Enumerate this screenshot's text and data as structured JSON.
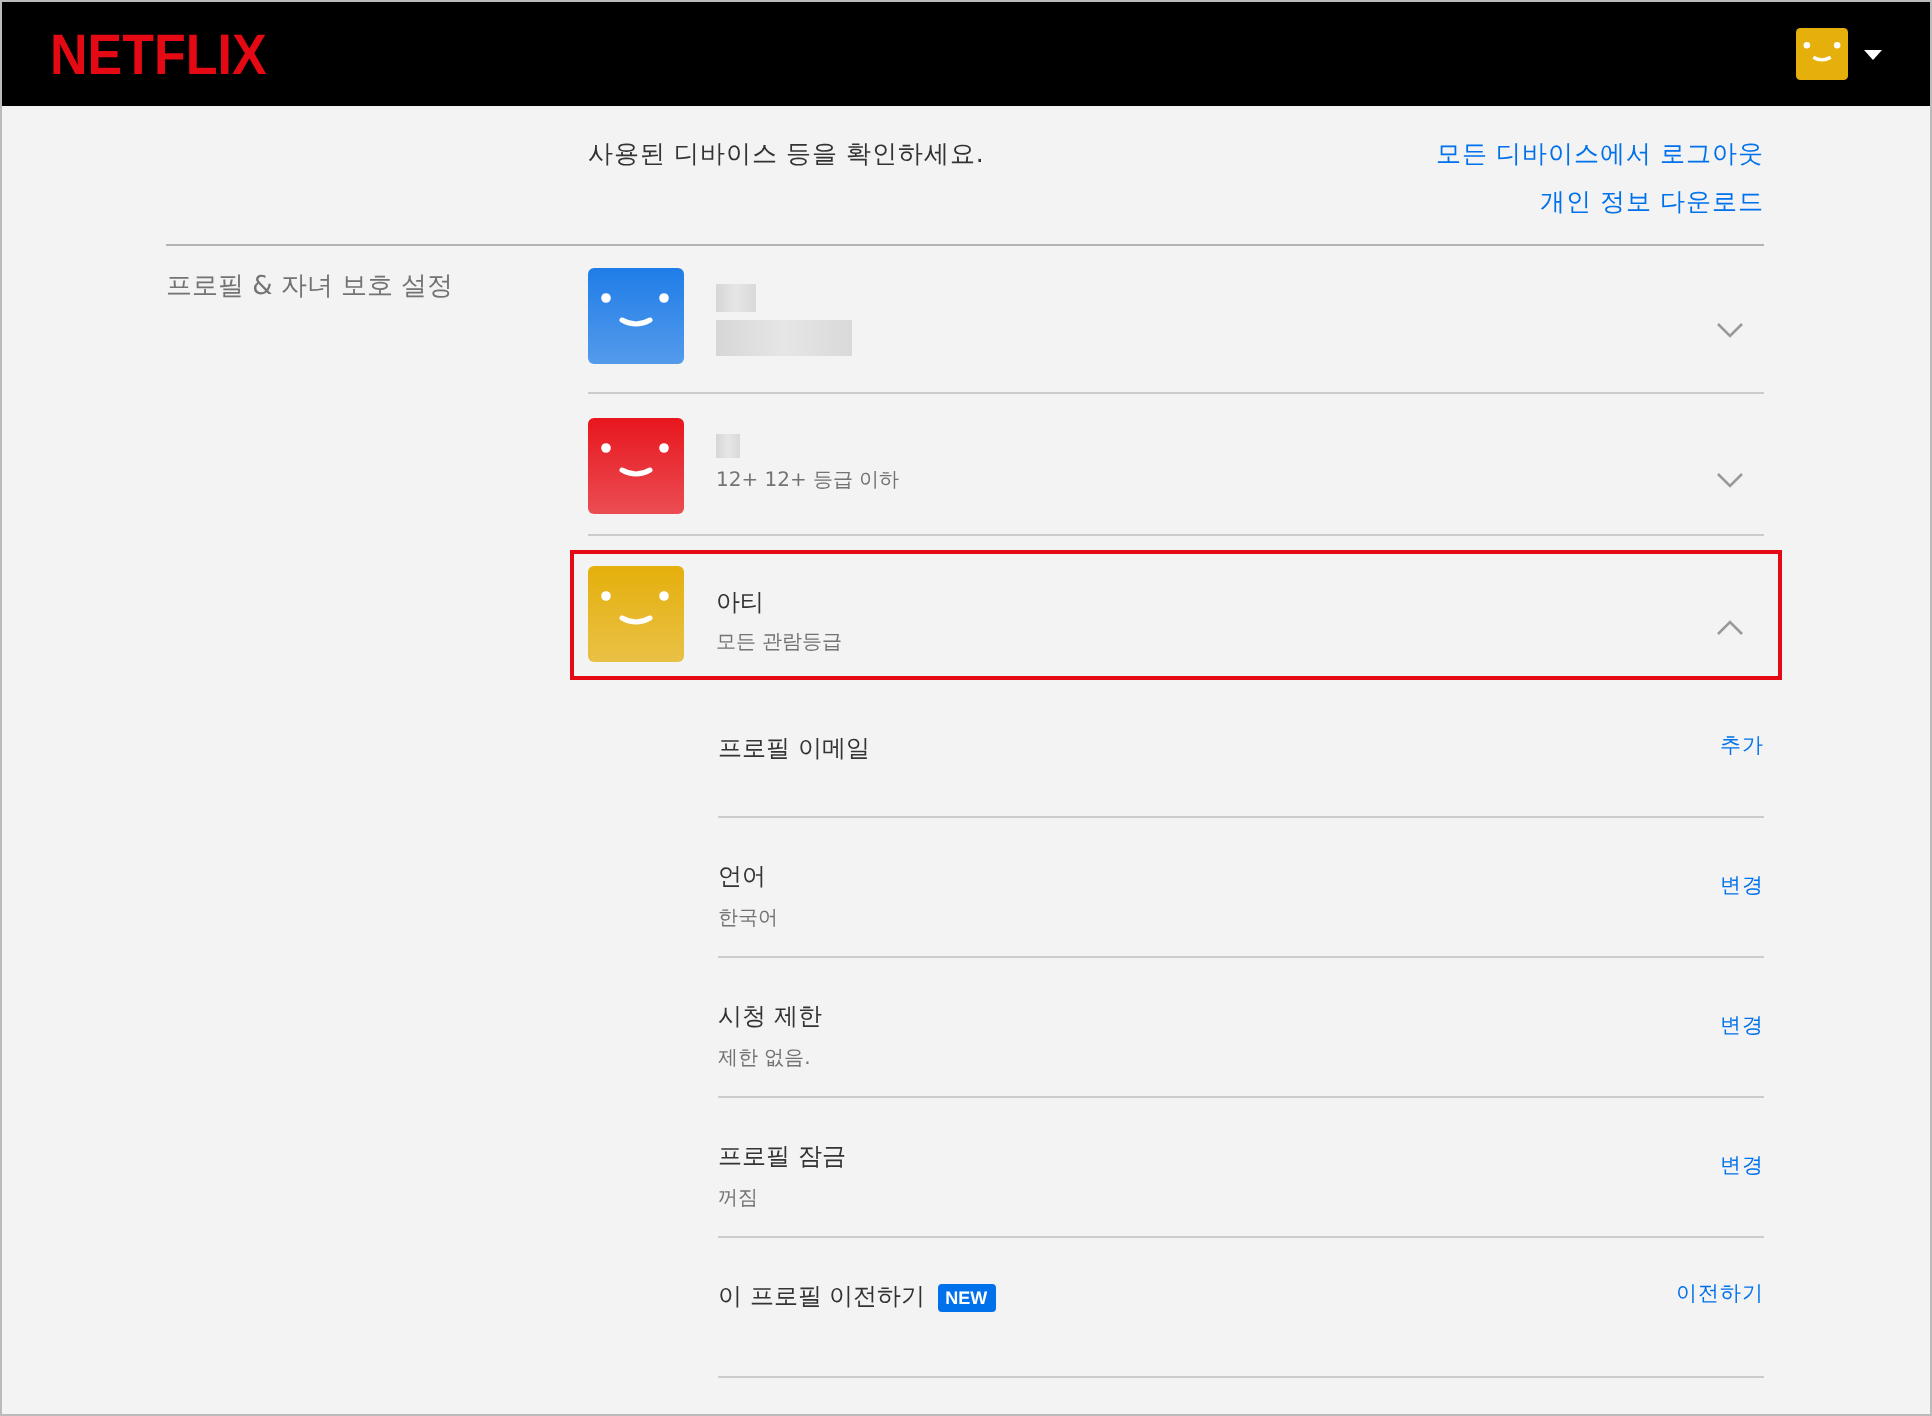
{
  "header": {
    "logo": "NETFLIX"
  },
  "security_section": {
    "description": "사용된 디바이스 등을 확인하세요.",
    "links": [
      {
        "label": "모든 디바이스에서 로그아웃"
      },
      {
        "label": "개인 정보 다운로드"
      }
    ]
  },
  "profiles_section": {
    "title": "프로필 & 자녀 보호 설정",
    "profiles": [
      {
        "name_redacted": true,
        "color": "#1f7de8",
        "expanded": false,
        "highlighted": false
      },
      {
        "name_redacted": true,
        "rating": "12+ 12+ 등급 이하",
        "color": "#e8161e",
        "expanded": false,
        "highlighted": false
      },
      {
        "name": "아티",
        "rating": "모든 관람등급",
        "color": "#e5b00c",
        "expanded": true,
        "highlighted": true,
        "settings": [
          {
            "label": "프로필 이메일",
            "action": "추가"
          },
          {
            "label": "언어",
            "value": "한국어",
            "action": "변경"
          },
          {
            "label": "시청 제한",
            "value": "제한 없음.",
            "action": "변경"
          },
          {
            "label": "프로필 잠금",
            "value": "꺼짐",
            "action": "변경"
          },
          {
            "label": "이 프로필 이전하기",
            "badge": "NEW",
            "action": "이전하기"
          }
        ]
      }
    ]
  }
}
